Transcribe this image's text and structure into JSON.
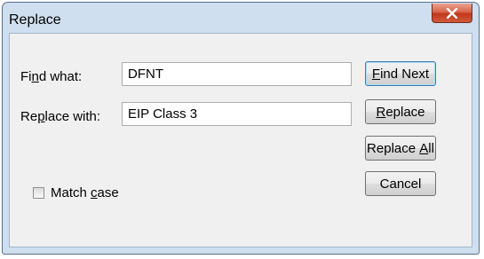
{
  "window": {
    "title": "Replace",
    "close_glyph": "✕"
  },
  "form": {
    "find_label_pre": "Fi",
    "find_label_key": "n",
    "find_label_post": "d what:",
    "find_value": "DFNT",
    "replace_label_pre": "Re",
    "replace_label_key": "p",
    "replace_label_post": "lace with:",
    "replace_value": "EIP Class 3",
    "match_case_pre": "Match ",
    "match_case_key": "c",
    "match_case_post": "ase",
    "match_case_checked": false
  },
  "buttons": {
    "find_next_key": "F",
    "find_next_post": "ind Next",
    "replace_key": "R",
    "replace_post": "eplace",
    "replace_all_pre": "Replace ",
    "replace_all_key": "A",
    "replace_all_post": "ll",
    "cancel": "Cancel"
  },
  "icons": {
    "close": "close-icon"
  }
}
